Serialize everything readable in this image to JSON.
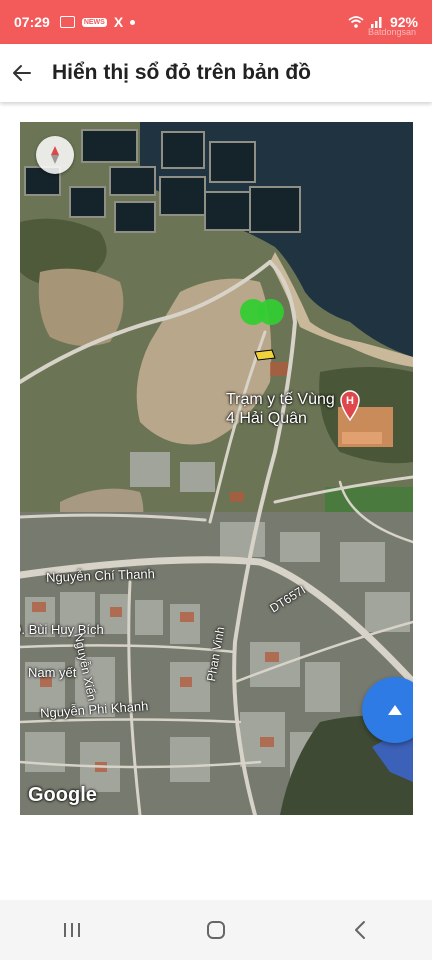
{
  "status_bar": {
    "time": "07:29",
    "notifications": [
      "image-icon",
      "news-icon",
      "x-icon",
      "dot-icon"
    ],
    "notification_text": "X",
    "battery": "92%",
    "watermark": "Batdongsan"
  },
  "app_bar": {
    "title": "Hiển thị sổ đỏ trên bản đồ"
  },
  "map": {
    "poi": {
      "label": "Trạm y tế Vùng 4 Hải Quân",
      "label_line1": "Trạm y tế Vùng",
      "label_line2": "4 Hải Quân",
      "pin_letter": "H",
      "pin_color": "#e0474c"
    },
    "streets": {
      "nguyen_chi_thanh": "Nguyễn Chí Thanh",
      "dt657i": "DT657I",
      "bui_huy_bich": "Đ. Bùi Huy Bích",
      "nguyen_xien": "Nguyễn Xiển",
      "phan_vinh": "Phan Vinh",
      "nam_yet": "Nam yết",
      "nguyen_phi_khanh": "Nguyễn Phi Khanh"
    },
    "attribution": "Google",
    "parcel_color": "#33cc33",
    "fab_color": "#2f7be6"
  },
  "colors": {
    "status_bar": "#f35b5b",
    "accent": "#2f7be6"
  }
}
